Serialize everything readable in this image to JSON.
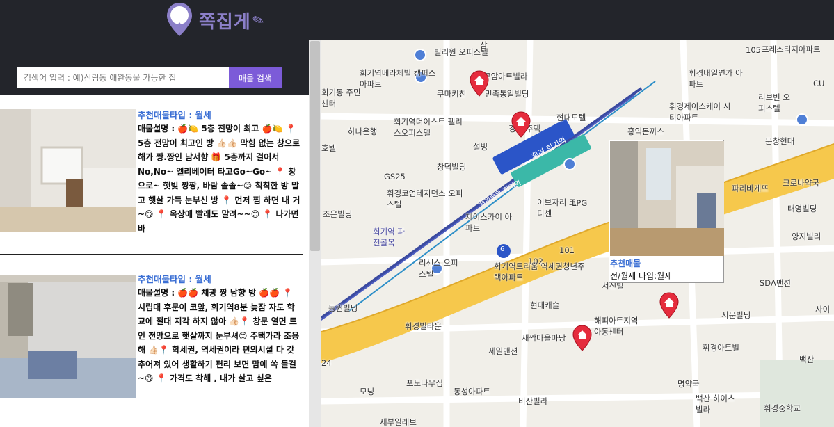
{
  "app": {
    "logo_text": "쪽집게",
    "logo_badge": "쪽집게"
  },
  "search": {
    "placeholder": "검색어 입력 : 예)신림동 애완동물 가능한 집",
    "button_label": "매물 검색"
  },
  "listings": [
    {
      "type_label": "추천매물타입 : 월세",
      "description": "매물설명 : 🍎🍋 5층 전망이 최고 🍎🍋 📍 5층 전망이 최고인 방 👍🏻👍🏻 막힘 없는 창으로 해가 짱.짱인 남서향 🎁 5층까지 걸어서 No,No~ 엘리베이터 타고Go~Go~ 📍 창으로~ 햇빛 짱짱, 바람 솔솔~😊 칙칙한 방 말고 햇살 가득 눈부신 방 📍 먼저 찜 하면 내 거~😋 📍 옥상에 빨래도 말려~~😊 📍 나가면 바"
    },
    {
      "type_label": "추천매물타입 : 월세",
      "description": "매물설명 : 🍎🍎 채광 짱 남향 방 🍎🍎 📍 시립대 후문이 코앞, 회기역8분 늦잠 자도 학교에 절대 지각 하지 않아 👍🏻📍 창문 열면 트인 전망으로 햇살까지 눈부셔😊 주택가라 조용해 👍🏻📍 학세권, 역세권이라 편의시설 다 갖추어져 있어 생활하기 편리 보면 맘에 쏙 들걸~😋 📍 가격도 착해 , 내가 살고 싶은"
    }
  ],
  "map": {
    "popup": {
      "title": "추천매물",
      "info": "전/월세 타입:월세"
    },
    "labels": [
      "빌리원 오피스텔",
      "삼",
      "회기역베라체빌 캠퍼스아파트",
      "구암아트빌라",
      "회기동 주민센터",
      "쿠마키친",
      "민족통일빌딩",
      "현대모텔",
      "회기역더이스트 팰리스오피스텔",
      "하나은행",
      "경동 주택",
      "홍익돈까스",
      "설빙",
      "문창현대",
      "창덕빌딩",
      "GS25",
      "휘경코업레지던스 오피스텔",
      "이브자리 코디센",
      "파리바게뜨",
      "크로바약국",
      "조은빌딩",
      "회기역 파전골목",
      "제이스카이 아파트",
      "태영빌딩",
      "양지빌리",
      "리센스 오피스텔",
      "회기역트리움 역세권청년주택아파트",
      "SDA맨션",
      "동원빌딩",
      "현대캐슬",
      "서문빌딩",
      "사이",
      "휘경빌타운",
      "새싹마을마당",
      "해피아트지역 아동센터",
      "휘경아트빌",
      "세일맨션",
      "백산",
      "명약국",
      "포도나무집",
      "동성아파트",
      "모닝",
      "비산빌라",
      "백산 하이츠빌라",
      "휘경중학교",
      "세부일레브",
      "휘경내일연가 아파트",
      "휘경제이스케이 시티아파트",
      "리브빈 오피스텔",
      "프레스티지아파트",
      "CU",
      "휘경 회기역",
      "경의중앙 회기역",
      "6",
      "101",
      "102",
      "105",
      "서진빌",
      "LPG",
      "호텔",
      "24"
    ]
  }
}
